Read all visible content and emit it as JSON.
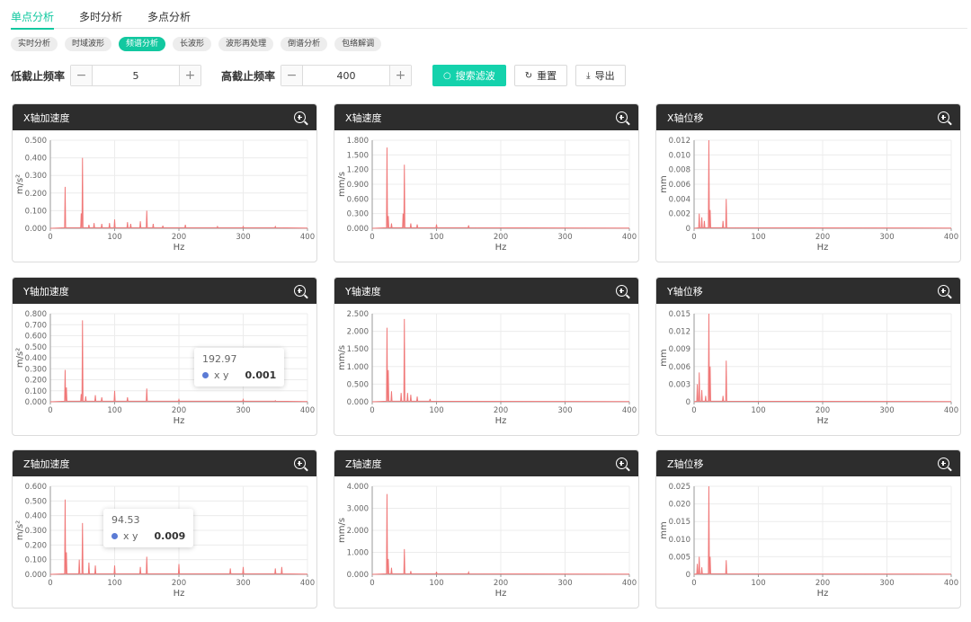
{
  "tabs": [
    {
      "label": "单点分析",
      "active": true
    },
    {
      "label": "多时分析",
      "active": false
    },
    {
      "label": "多点分析",
      "active": false
    }
  ],
  "subtabs": [
    {
      "label": "实时分析",
      "active": false
    },
    {
      "label": "时域波形",
      "active": false
    },
    {
      "label": "频谱分析",
      "active": true
    },
    {
      "label": "长波形",
      "active": false
    },
    {
      "label": "波形再处理",
      "active": false
    },
    {
      "label": "倒谱分析",
      "active": false
    },
    {
      "label": "包络解调",
      "active": false
    }
  ],
  "filters": {
    "low_label": "低截止频率",
    "low_value": "5",
    "high_label": "高截止频率",
    "high_value": "400",
    "minus": "−",
    "plus": "+",
    "search_label": "搜索滤波",
    "reset_label": "重置",
    "export_label": "导出"
  },
  "colors": {
    "accent": "#12c8a0",
    "series": "#f07878",
    "header": "#2d2d2d",
    "tooltip_dot": "#5b7bd5"
  },
  "charts": [
    {
      "title": "X轴加速度",
      "ylabel": "m/s²",
      "xlabel": "Hz",
      "chart_data": {
        "type": "line",
        "xlim": [
          0,
          400
        ],
        "ylim": [
          0,
          0.5
        ],
        "yticks": [
          "0.000",
          "0.100",
          "0.200",
          "0.300",
          "0.400",
          "0.500"
        ],
        "xticks": [
          "0",
          "100",
          "200",
          "300",
          "400"
        ],
        "peaks": [
          [
            23,
            0.235
          ],
          [
            48,
            0.085
          ],
          [
            50,
            0.4
          ],
          [
            60,
            0.02
          ],
          [
            68,
            0.03
          ],
          [
            80,
            0.025
          ],
          [
            92,
            0.03
          ],
          [
            100,
            0.05
          ],
          [
            120,
            0.035
          ],
          [
            125,
            0.025
          ],
          [
            140,
            0.04
          ],
          [
            150,
            0.1
          ],
          [
            160,
            0.025
          ],
          [
            175,
            0.015
          ],
          [
            210,
            0.02
          ],
          [
            260,
            0.01
          ],
          [
            300,
            0.01
          ],
          [
            350,
            0.01
          ]
        ]
      }
    },
    {
      "title": "X轴速度",
      "ylabel": "mm/s",
      "xlabel": "Hz",
      "chart_data": {
        "type": "line",
        "xlim": [
          0,
          400
        ],
        "ylim": [
          0,
          1.8
        ],
        "yticks": [
          "0.000",
          "0.300",
          "0.600",
          "0.900",
          "1.200",
          "1.500",
          "1.800"
        ],
        "xticks": [
          "0",
          "100",
          "200",
          "300",
          "400"
        ],
        "peaks": [
          [
            23,
            1.65
          ],
          [
            25,
            0.25
          ],
          [
            30,
            0.1
          ],
          [
            48,
            0.3
          ],
          [
            50,
            1.3
          ],
          [
            60,
            0.1
          ],
          [
            70,
            0.08
          ],
          [
            100,
            0.08
          ],
          [
            150,
            0.06
          ]
        ]
      }
    },
    {
      "title": "X轴位移",
      "ylabel": "mm",
      "xlabel": "Hz",
      "chart_data": {
        "type": "line",
        "xlim": [
          0,
          400
        ],
        "ylim": [
          0,
          0.012
        ],
        "yticks": [
          "0",
          "0.002",
          "0.004",
          "0.006",
          "0.008",
          "0.010",
          "0.012"
        ],
        "xticks": [
          "0",
          "100",
          "200",
          "300",
          "400"
        ],
        "peaks": [
          [
            8,
            0.002
          ],
          [
            12,
            0.0015
          ],
          [
            16,
            0.001
          ],
          [
            23,
            0.012
          ],
          [
            25,
            0.0025
          ],
          [
            45,
            0.001
          ],
          [
            50,
            0.004
          ]
        ]
      }
    },
    {
      "title": "Y轴加速度",
      "ylabel": "m/s²",
      "xlabel": "Hz",
      "chart_data": {
        "type": "line",
        "xlim": [
          0,
          400
        ],
        "ylim": [
          0,
          0.8
        ],
        "yticks": [
          "0.000",
          "0.100",
          "0.200",
          "0.300",
          "0.400",
          "0.500",
          "0.600",
          "0.700",
          "0.800"
        ],
        "xticks": [
          "0",
          "100",
          "200",
          "300",
          "400"
        ],
        "peaks": [
          [
            23,
            0.29
          ],
          [
            25,
            0.13
          ],
          [
            48,
            0.07
          ],
          [
            50,
            0.74
          ],
          [
            55,
            0.05
          ],
          [
            70,
            0.06
          ],
          [
            80,
            0.04
          ],
          [
            100,
            0.1
          ],
          [
            120,
            0.04
          ],
          [
            150,
            0.12
          ],
          [
            200,
            0.02
          ],
          [
            300,
            0.02
          ],
          [
            350,
            0.01
          ]
        ]
      }
    },
    {
      "title": "Y轴速度",
      "ylabel": "mm/s",
      "xlabel": "Hz",
      "chart_data": {
        "type": "line",
        "xlim": [
          0,
          400
        ],
        "ylim": [
          0,
          2.5
        ],
        "yticks": [
          "0.000",
          "0.500",
          "1.000",
          "1.500",
          "2.000",
          "2.500"
        ],
        "xticks": [
          "0",
          "100",
          "200",
          "300",
          "400"
        ],
        "peaks": [
          [
            23,
            2.1
          ],
          [
            25,
            0.9
          ],
          [
            30,
            0.3
          ],
          [
            45,
            0.25
          ],
          [
            50,
            2.35
          ],
          [
            55,
            0.25
          ],
          [
            60,
            0.2
          ],
          [
            70,
            0.15
          ],
          [
            90,
            0.08
          ]
        ]
      }
    },
    {
      "title": "Y轴位移",
      "ylabel": "mm",
      "xlabel": "Hz",
      "chart_data": {
        "type": "line",
        "xlim": [
          0,
          400
        ],
        "ylim": [
          0,
          0.015
        ],
        "yticks": [
          "0",
          "0.003",
          "0.006",
          "0.009",
          "0.012",
          "0.015"
        ],
        "xticks": [
          "0",
          "100",
          "200",
          "300",
          "400"
        ],
        "peaks": [
          [
            5,
            0.003
          ],
          [
            8,
            0.005
          ],
          [
            12,
            0.002
          ],
          [
            18,
            0.001
          ],
          [
            23,
            0.015
          ],
          [
            25,
            0.006
          ],
          [
            45,
            0.001
          ],
          [
            50,
            0.007
          ]
        ]
      }
    },
    {
      "title": "Z轴加速度",
      "ylabel": "m/s²",
      "xlabel": "Hz",
      "chart_data": {
        "type": "line",
        "xlim": [
          0,
          400
        ],
        "ylim": [
          0,
          0.6
        ],
        "yticks": [
          "0.000",
          "0.100",
          "0.200",
          "0.300",
          "0.400",
          "0.500",
          "0.600"
        ],
        "xticks": [
          "0",
          "100",
          "200",
          "300",
          "400"
        ],
        "peaks": [
          [
            23,
            0.51
          ],
          [
            25,
            0.15
          ],
          [
            45,
            0.1
          ],
          [
            50,
            0.35
          ],
          [
            60,
            0.08
          ],
          [
            70,
            0.06
          ],
          [
            100,
            0.06
          ],
          [
            140,
            0.05
          ],
          [
            150,
            0.12
          ],
          [
            200,
            0.07
          ],
          [
            280,
            0.04
          ],
          [
            300,
            0.05
          ],
          [
            350,
            0.04
          ],
          [
            360,
            0.05
          ]
        ]
      }
    },
    {
      "title": "Z轴速度",
      "ylabel": "mm/s",
      "xlabel": "Hz",
      "chart_data": {
        "type": "line",
        "xlim": [
          0,
          400
        ],
        "ylim": [
          0,
          4
        ],
        "yticks": [
          "0.000",
          "1.000",
          "2.000",
          "3.000",
          "4.000"
        ],
        "xticks": [
          "0",
          "100",
          "200",
          "300",
          "400"
        ],
        "peaks": [
          [
            23,
            3.65
          ],
          [
            25,
            0.7
          ],
          [
            30,
            0.3
          ],
          [
            50,
            1.15
          ],
          [
            60,
            0.15
          ],
          [
            100,
            0.12
          ],
          [
            150,
            0.1
          ]
        ]
      }
    },
    {
      "title": "Z轴位移",
      "ylabel": "mm",
      "xlabel": "Hz",
      "chart_data": {
        "type": "line",
        "xlim": [
          0,
          400
        ],
        "ylim": [
          0,
          0.025
        ],
        "yticks": [
          "0",
          "0.005",
          "0.010",
          "0.015",
          "0.020",
          "0.025"
        ],
        "xticks": [
          "0",
          "100",
          "200",
          "300",
          "400"
        ],
        "peaks": [
          [
            5,
            0.003
          ],
          [
            8,
            0.005
          ],
          [
            12,
            0.002
          ],
          [
            23,
            0.025
          ],
          [
            25,
            0.005
          ],
          [
            50,
            0.004
          ]
        ]
      }
    }
  ],
  "tooltips": [
    {
      "chart": 3,
      "x_label": "192.97",
      "series": "x y",
      "value": "0.001"
    },
    {
      "chart": 6,
      "x_label": "94.53",
      "series": "x y",
      "value": "0.009"
    }
  ]
}
